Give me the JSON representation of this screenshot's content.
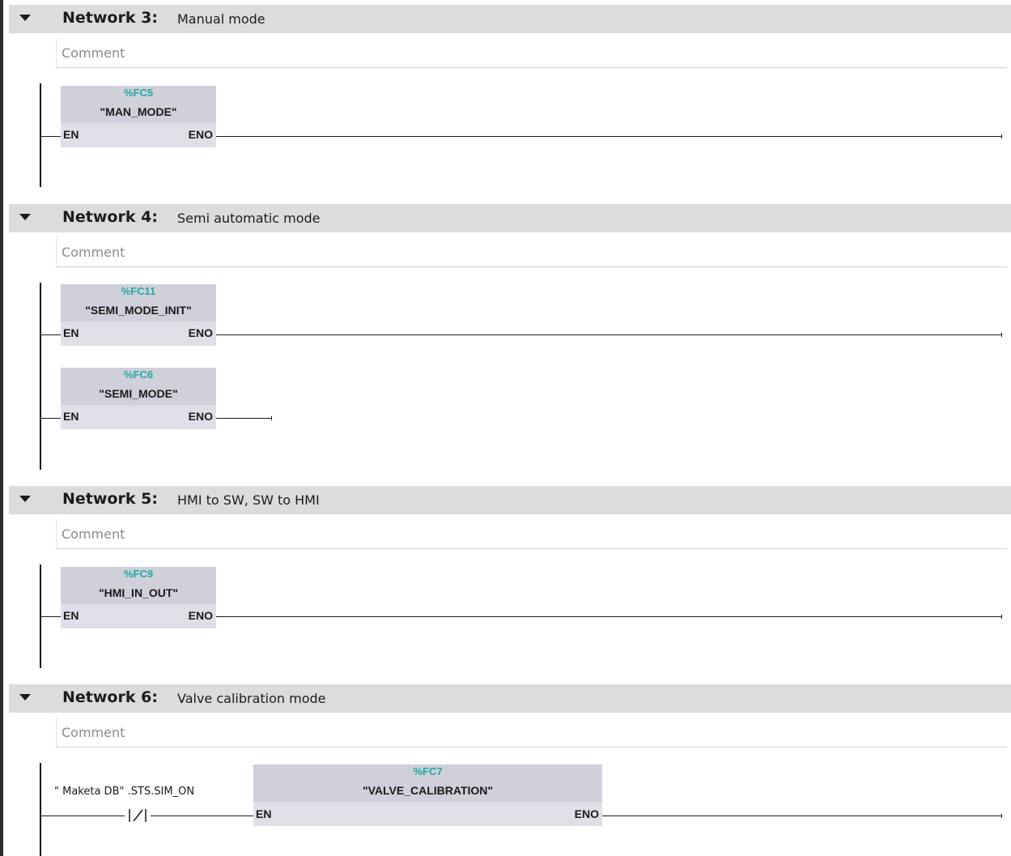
{
  "networks": [
    {
      "label": "Network 3:",
      "title": "Manual mode",
      "comment": "Comment",
      "blocks": [
        {
          "address": "%FC5",
          "name": "\"MAN_MODE\"",
          "en": "EN",
          "eno": "ENO"
        }
      ]
    },
    {
      "label": "Network 4:",
      "title": "Semi automatic mode",
      "comment": "Comment",
      "blocks": [
        {
          "address": "%FC11",
          "name": "\"SEMI_MODE_INIT\"",
          "en": "EN",
          "eno": "ENO"
        },
        {
          "address": "%FC6",
          "name": "\"SEMI_MODE\"",
          "en": "EN",
          "eno": "ENO"
        }
      ]
    },
    {
      "label": "Network 5:",
      "title": "HMI to SW, SW to HMI",
      "comment": "Comment",
      "blocks": [
        {
          "address": "%FC9",
          "name": "\"HMI_IN_OUT\"",
          "en": "EN",
          "eno": "ENO"
        }
      ]
    },
    {
      "label": "Network 6:",
      "title": "Valve calibration mode",
      "comment": "Comment",
      "contact": {
        "operand": "\" Maketa DB\" .STS.SIM_ON",
        "type": "normally-closed-contact"
      },
      "blocks": [
        {
          "address": "%FC7",
          "name": "\"VALVE_CALIBRATION\"",
          "en": "EN",
          "eno": "ENO"
        }
      ]
    }
  ]
}
